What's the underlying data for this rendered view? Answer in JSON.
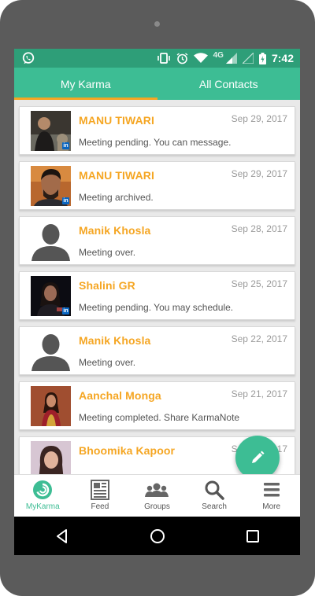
{
  "status_bar": {
    "time": "7:42",
    "network": "4G"
  },
  "tabs": [
    {
      "label": "My Karma",
      "active": true
    },
    {
      "label": "All Contacts",
      "active": false
    }
  ],
  "meetings": [
    {
      "name": "MANU TIWARI",
      "date": "Sep 29, 2017",
      "status": "Meeting pending. You can message."
    },
    {
      "name": "MANU TIWARI",
      "date": "Sep 29, 2017",
      "status": "Meeting archived."
    },
    {
      "name": "Manik Khosla",
      "date": "Sep 28, 2017",
      "status": "Meeting over."
    },
    {
      "name": "Shalini GR",
      "date": "Sep 25, 2017",
      "status": "Meeting pending. You may schedule."
    },
    {
      "name": "Manik Khosla",
      "date": "Sep 22, 2017",
      "status": "Meeting over."
    },
    {
      "name": "Aanchal Monga",
      "date": "Sep 21, 2017",
      "status": "Meeting completed. Share KarmaNote"
    },
    {
      "name": "Bhoomika Kapoor",
      "date": "Sep 20, 2017",
      "status": ""
    }
  ],
  "bottom_nav": [
    {
      "label": "MyKarma",
      "icon": "karma-swirl-icon",
      "active": true
    },
    {
      "label": "Feed",
      "icon": "newspaper-icon",
      "active": false
    },
    {
      "label": "Groups",
      "icon": "people-icon",
      "active": false
    },
    {
      "label": "Search",
      "icon": "search-icon",
      "active": false
    },
    {
      "label": "More",
      "icon": "menu-icon",
      "active": false
    }
  ],
  "colors": {
    "primary": "#3dbd94",
    "status_bar": "#2e9e78",
    "accent": "#f5a623"
  }
}
